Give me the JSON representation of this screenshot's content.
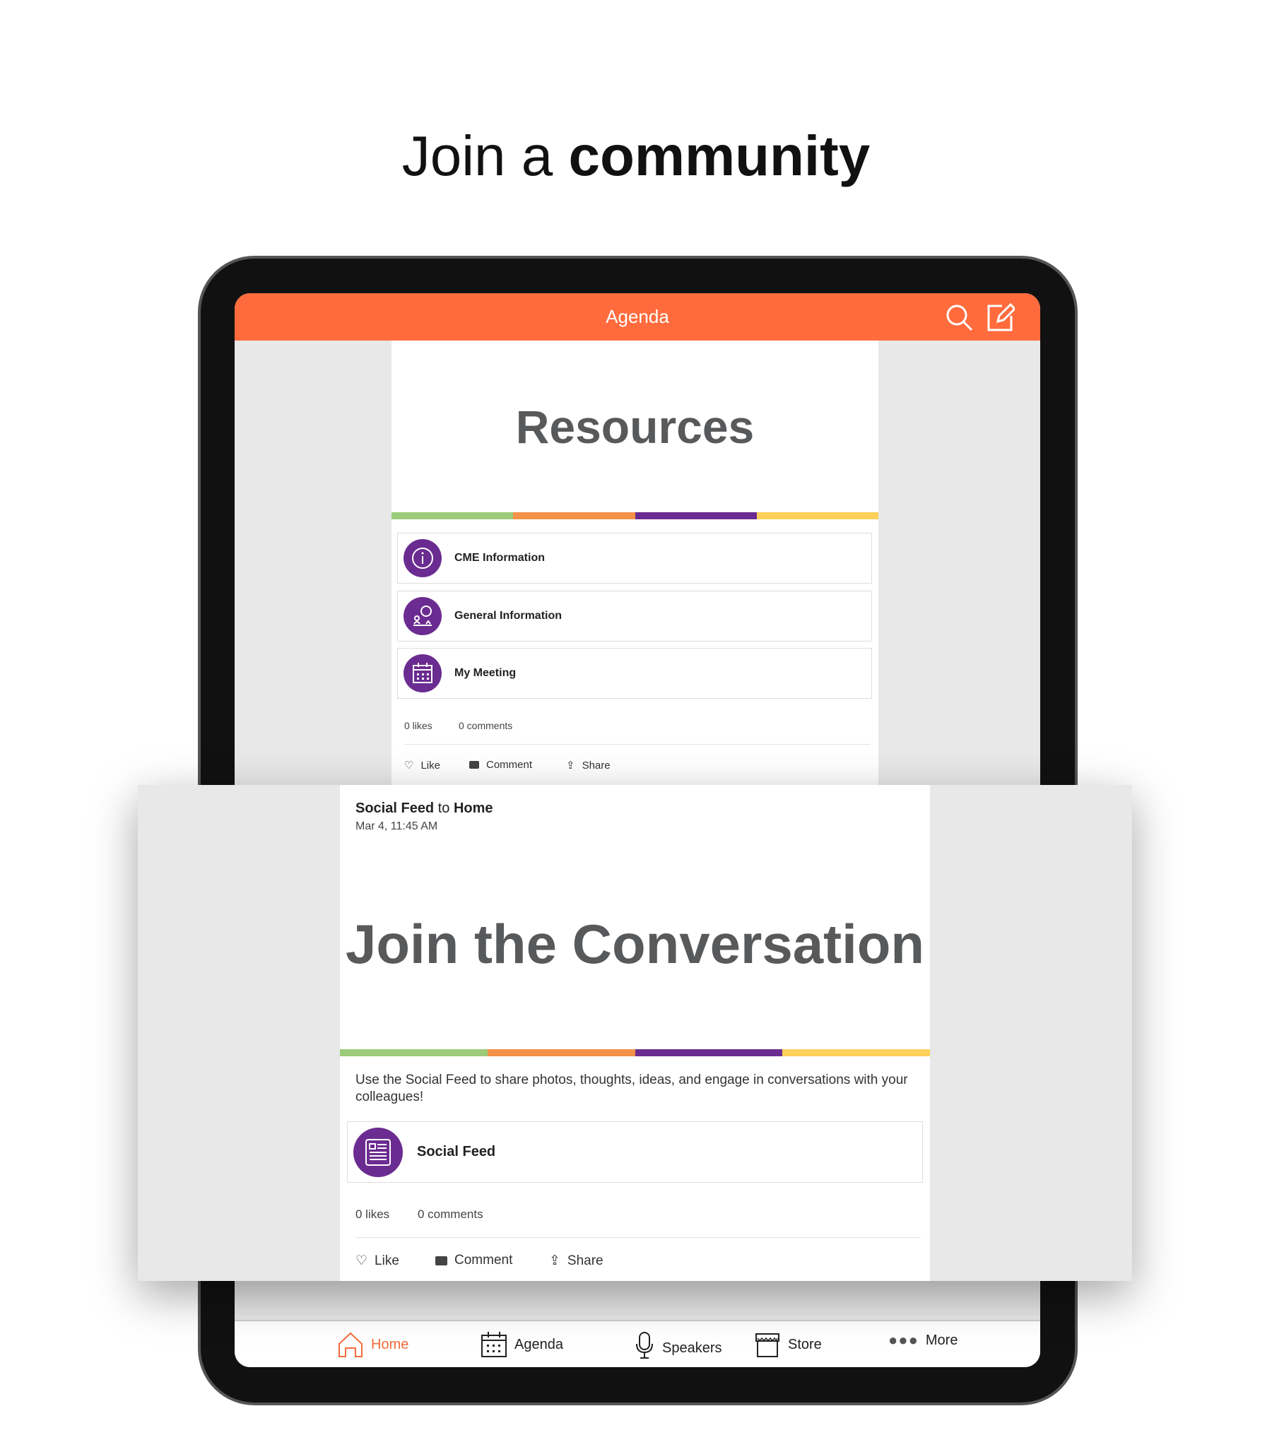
{
  "headline": {
    "light": "Join a",
    "bold": "community"
  },
  "topbar": {
    "title": "Agenda",
    "icons": [
      "search-icon",
      "compose-icon"
    ],
    "color": "#ff6b3d"
  },
  "colors": {
    "purple": "#6b2c91",
    "bar": [
      "#9ccc7a",
      "#f39149",
      "#6b2c91",
      "#fdd05a"
    ]
  },
  "post1": {
    "banner_title": "Resources",
    "items": [
      {
        "label": "CME Information",
        "icon": "info-icon"
      },
      {
        "label": "General Information",
        "icon": "person-info-icon"
      },
      {
        "label": "My Meeting",
        "icon": "calendar-icon"
      }
    ],
    "likes": "0 likes",
    "comments": "0 comments",
    "actions": {
      "like": "Like",
      "comment": "Comment",
      "share": "Share"
    }
  },
  "post2": {
    "source": "Social Feed",
    "to": "to",
    "target": "Home",
    "date": "Mar 4, 11:45 AM",
    "banner_title": "Join the Conversation",
    "description": "Use the Social Feed to share photos, thoughts, ideas, and engage in conversations with your colleagues!",
    "item": {
      "label": "Social Feed",
      "icon": "newsfeed-icon"
    },
    "likes": "0 likes",
    "comments": "0 comments",
    "actions": {
      "like": "Like",
      "comment": "Comment",
      "share": "Share"
    }
  },
  "nav": {
    "items": [
      {
        "label": "Home",
        "icon": "home-icon",
        "active": true
      },
      {
        "label": "Agenda",
        "icon": "calendar-icon"
      },
      {
        "label": "Speakers",
        "icon": "microphone-icon"
      },
      {
        "label": "Store",
        "icon": "store-icon"
      },
      {
        "label": "More",
        "icon": "more-icon"
      }
    ]
  }
}
